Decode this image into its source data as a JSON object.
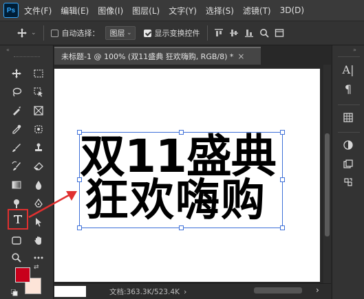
{
  "app": {
    "logo": "Ps"
  },
  "menu": {
    "items": [
      "文件(F)",
      "编辑(E)",
      "图像(I)",
      "图层(L)",
      "文字(Y)",
      "选择(S)",
      "滤镜(T)",
      "3D(D)"
    ]
  },
  "options": {
    "auto_select_label": "自动选择：",
    "auto_select_checked": false,
    "layer_dropdown": "图层",
    "show_transform_label": "显示变换控件",
    "show_transform_checked": true
  },
  "document": {
    "tab_title": "未标题-1 @ 100% (双11盛典 狂欢嗨购, RGB/8) *",
    "close_icon": "×",
    "text_line1": "双11盛典",
    "text_line2": "狂欢嗨购"
  },
  "status": {
    "doc_info": "文档:363.3K/523.4K",
    "arrow": "›"
  },
  "colors": {
    "foreground": "#c8001b",
    "background": "#fde4d8",
    "highlight": "#e03030",
    "selection": "#3d6fd8"
  },
  "right_panel": {
    "char_icon": "A|",
    "para_icon": "¶"
  }
}
